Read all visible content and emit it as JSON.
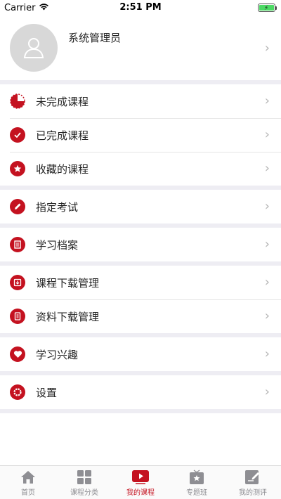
{
  "status_bar": {
    "carrier": "Carrier",
    "time": "2:51 PM",
    "battery_level": 1.0,
    "battery_color": "#4cd964"
  },
  "profile": {
    "name": "系统管理员"
  },
  "accent_color": "#c41220",
  "menu_groups": [
    [
      {
        "label": "未完成课程",
        "icon": "pie-progress-icon"
      },
      {
        "label": "已完成课程",
        "icon": "checkmark-icon"
      },
      {
        "label": "收藏的课程",
        "icon": "star-icon"
      }
    ],
    [
      {
        "label": "指定考试",
        "icon": "pencil-icon"
      }
    ],
    [
      {
        "label": "学习档案",
        "icon": "document-icon"
      }
    ],
    [
      {
        "label": "课程下载管理",
        "icon": "download-icon"
      },
      {
        "label": "资料下载管理",
        "icon": "file-icon"
      }
    ],
    [
      {
        "label": "学习兴趣",
        "icon": "heart-icon"
      }
    ],
    [
      {
        "label": "设置",
        "icon": "gear-icon"
      }
    ]
  ],
  "tabbar": {
    "active_index": 2,
    "tabs": [
      {
        "label": "首页",
        "icon": "home-icon"
      },
      {
        "label": "课程分类",
        "icon": "grid-icon"
      },
      {
        "label": "我的课程",
        "icon": "play-icon"
      },
      {
        "label": "专题班",
        "icon": "star-board-icon"
      },
      {
        "label": "我的测评",
        "icon": "edit-icon"
      }
    ]
  }
}
